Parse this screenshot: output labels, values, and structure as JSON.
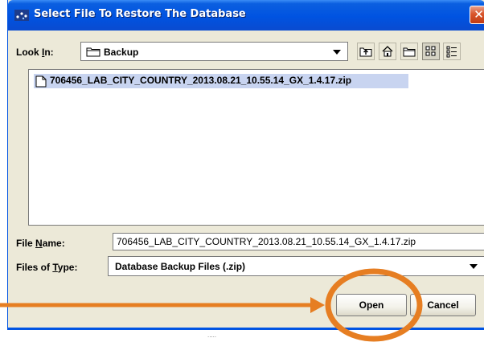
{
  "window": {
    "title": "Select File To Restore The Database",
    "close_glyph": "✕"
  },
  "look_in": {
    "label_pre": "Look ",
    "label_mnemonic": "I",
    "label_post": "n:",
    "value": "Backup",
    "folder_icon": "folder-icon"
  },
  "toolbar": {
    "buttons": [
      "up-one-level-icon",
      "home-icon",
      "new-folder-icon",
      "list-view-icon",
      "details-view-icon"
    ],
    "selected": "list-view-icon"
  },
  "files": [
    {
      "name": "706456_LAB_CITY_COUNTRY_2013.08.21_10.55.14_GX_1.4.17.zip",
      "icon": "file-icon",
      "selected": true
    }
  ],
  "file_name": {
    "label_pre": "File ",
    "label_mnemonic": "N",
    "label_post": "ame:",
    "value": "706456_LAB_CITY_COUNTRY_2013.08.21_10.55.14_GX_1.4.17.zip"
  },
  "file_type": {
    "label_pre": "Files of ",
    "label_mnemonic": "T",
    "label_post": "ype:",
    "value": "Database Backup Files (.zip)"
  },
  "buttons": {
    "open": "Open",
    "cancel": "Cancel"
  },
  "colors": {
    "title_bar": "#0053e1",
    "dialog_bg": "#ece9d8",
    "annotation_orange": "#e67e22",
    "selection_bg": "#c8d4f0"
  }
}
